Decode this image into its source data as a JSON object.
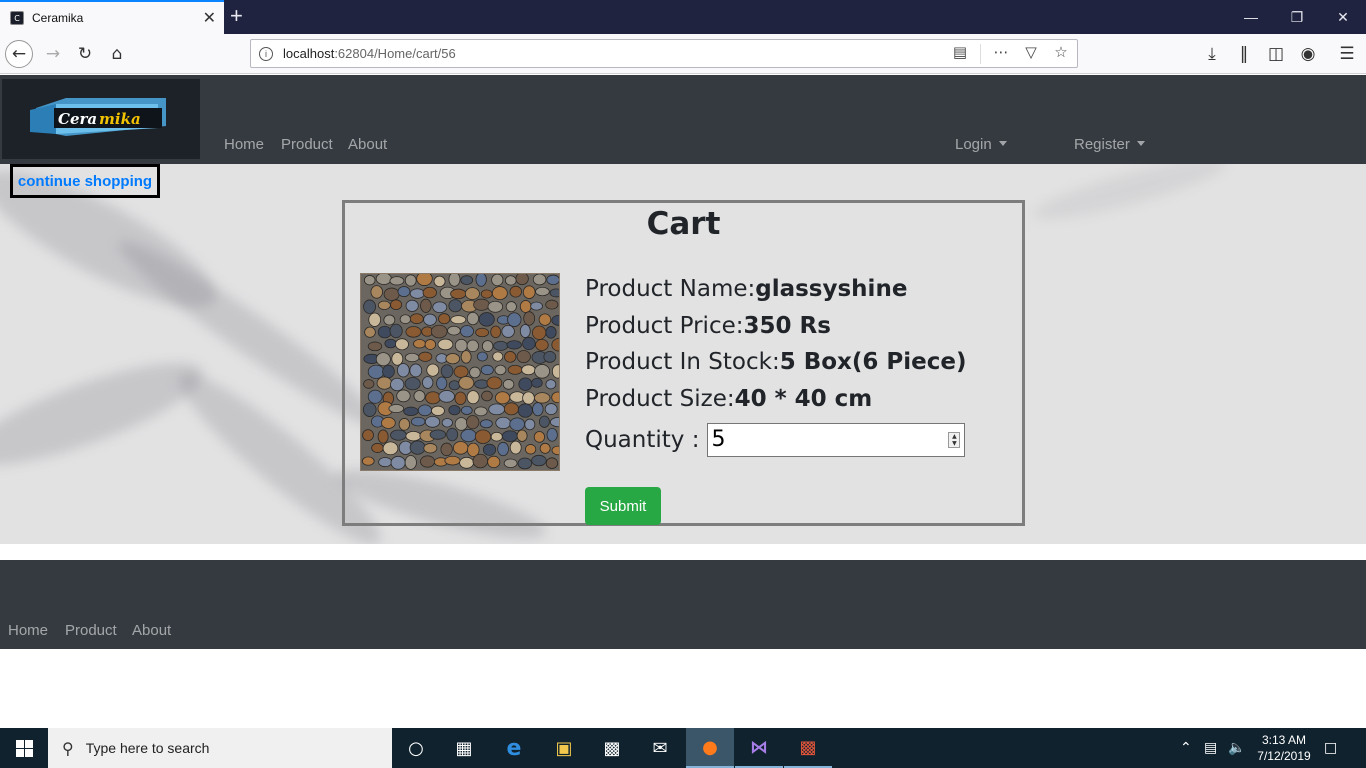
{
  "browser": {
    "tab_title": "Ceramika",
    "url_host": "localhost",
    "url_rest": ":62804/Home/cart/56",
    "new_tab": "+",
    "tab_close": "✕"
  },
  "navbar": {
    "logo_text_1": "Cera",
    "logo_text_2": "mika",
    "links": [
      "Home",
      "Product",
      "About"
    ],
    "login": "Login",
    "register": "Register"
  },
  "continue_label": "continue shopping",
  "cart": {
    "title": "Cart",
    "name_label": "Product Name:",
    "name_value": "glassyshine",
    "price_label": "Product Price:",
    "price_value": "350 Rs",
    "stock_label": "Product In Stock:",
    "stock_value": "5 Box(6 Piece)",
    "size_label": "Product Size:",
    "size_value": "40 * 40 cm",
    "quantity_label": "Quantity :",
    "quantity_value": "5",
    "submit_label": "Submit"
  },
  "footer": {
    "links": [
      "Home",
      "Product",
      "About"
    ]
  },
  "taskbar": {
    "search_placeholder": "Type here to search",
    "time": "3:13 AM",
    "date": "7/12/2019"
  },
  "colors": {
    "navbar_bg": "#343a40",
    "link_blue": "#007bff",
    "submit_green": "#28a745",
    "browser_accent": "#0a84ff"
  }
}
